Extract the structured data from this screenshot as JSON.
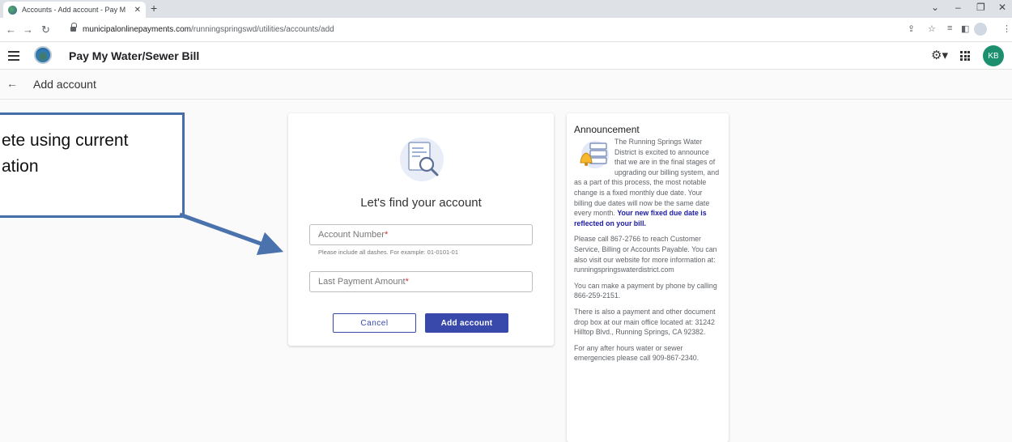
{
  "browser": {
    "tab_title": "Accounts - Add account - Pay M",
    "url_host": "municipalonlinepayments.com",
    "url_path": "/runningspringswd/utilities/accounts/add"
  },
  "appbar": {
    "title": "Pay My Water/Sewer Bill",
    "avatar_initials": "KB"
  },
  "subheader": {
    "title": "Add account"
  },
  "form": {
    "heading": "Let's find your account",
    "account_number_label": "Account Number",
    "account_number_hint": "Please include all dashes. For example: 01-0101-01",
    "last_payment_label": "Last Payment Amount",
    "required_mark": "*",
    "cancel_label": "Cancel",
    "add_label": "Add account"
  },
  "announcement": {
    "title": "Announcement",
    "p1_text": "The Running Springs Water District is excited to announce that we are in the final stages of upgrading our billing system, and as a part of this process, the most notable change is a fixed monthly due date. Your billing due dates will now be the same date every month.",
    "p1_bold": "Your new fixed due date is reflected on your bill.",
    "p2": "Please call 867-2766 to reach Customer Service, Billing or Accounts Payable. You can also visit our website for more information at: runningspringswaterdistrict.com",
    "p3": "You can make a payment by phone by calling 866-259-2151.",
    "p4": "There is also a payment and other document drop box at our main office located at: 31242 Hilltop Blvd., Running Springs, CA 92382.",
    "p5": "For any after hours water or sewer emergencies please call 909-867-2340."
  },
  "callout": {
    "line1": "ete using current",
    "line2": "ation"
  },
  "colors": {
    "primary": "#3949ab",
    "avatar": "#1b8f6e",
    "callout_border": "#4a73ae",
    "link_bold": "#1a1aa6"
  }
}
